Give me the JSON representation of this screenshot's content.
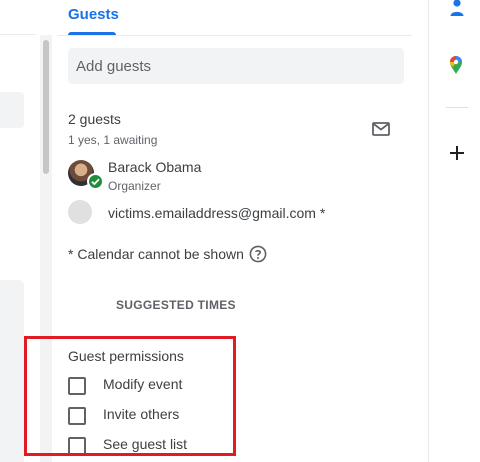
{
  "tabs": {
    "guests_label": "Guests"
  },
  "guests": {
    "add_placeholder": "Add guests",
    "count_label": "2 guests",
    "summary": "1 yes, 1 awaiting",
    "list": [
      {
        "name": "Barack Obama",
        "role": "Organizer",
        "status": "accepted"
      },
      {
        "name": "victims.emailaddress@gmail.com *",
        "role": "",
        "status": "awaiting"
      }
    ],
    "calendar_note": "* Calendar cannot be shown",
    "suggested_times_label": "SUGGESTED TIMES"
  },
  "permissions": {
    "title": "Guest permissions",
    "options": [
      {
        "label": "Modify event",
        "checked": false
      },
      {
        "label": "Invite others",
        "checked": false
      },
      {
        "label": "See guest list",
        "checked": false
      }
    ]
  },
  "icons": {
    "email": "email-icon",
    "help": "help-icon",
    "contacts": "contacts-icon",
    "maps": "maps-icon",
    "add": "plus-icon"
  },
  "colors": {
    "accent": "#1a73e8",
    "highlight_box": "#e01b24",
    "accepted": "#1e8e3e"
  }
}
